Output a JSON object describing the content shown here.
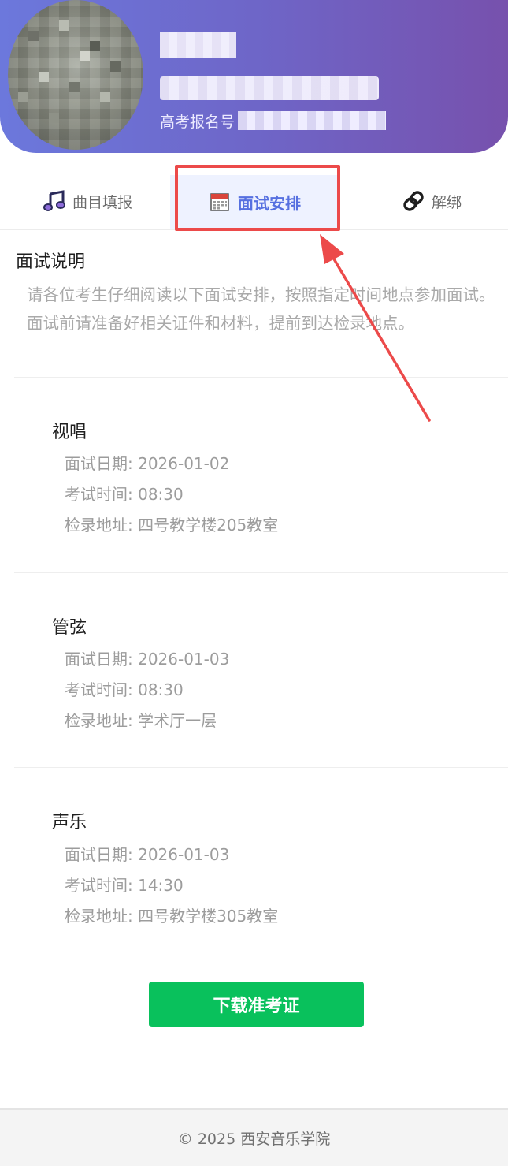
{
  "header": {
    "exam_no_label": "高考报名号"
  },
  "tabs": [
    {
      "label": "曲目填报",
      "icon": "music-note-icon"
    },
    {
      "label": "面试安排",
      "icon": "calendar-icon",
      "active": true
    },
    {
      "label": "解绑",
      "icon": "link-icon"
    }
  ],
  "notice": {
    "title": "面试说明",
    "text": "请各位考生仔细阅读以下面试安排，按照指定时间地点参加面试。面试前请准备好相关证件和材料，提前到达检录地点。"
  },
  "sections": [
    {
      "title": "视唱",
      "date": "面试日期: 2026-01-02",
      "time": "考试时间: 08:30",
      "place": "检录地址: 四号教学楼205教室"
    },
    {
      "title": "管弦",
      "date": "面试日期: 2026-01-03",
      "time": "考试时间: 08:30",
      "place": "检录地址: 学术厅一层"
    },
    {
      "title": "声乐",
      "date": "面试日期: 2026-01-03",
      "time": "考试时间: 14:30",
      "place": "检录地址: 四号教学楼305教室"
    }
  ],
  "download_button": "下载准考证",
  "footer": "© 2025 西安音乐学院",
  "colors": {
    "header_gradient_start": "#6c78dc",
    "header_gradient_end": "#7751ad",
    "active_tab": "#5670e0",
    "highlight": "#ec4a4a",
    "button": "#09c15c"
  }
}
